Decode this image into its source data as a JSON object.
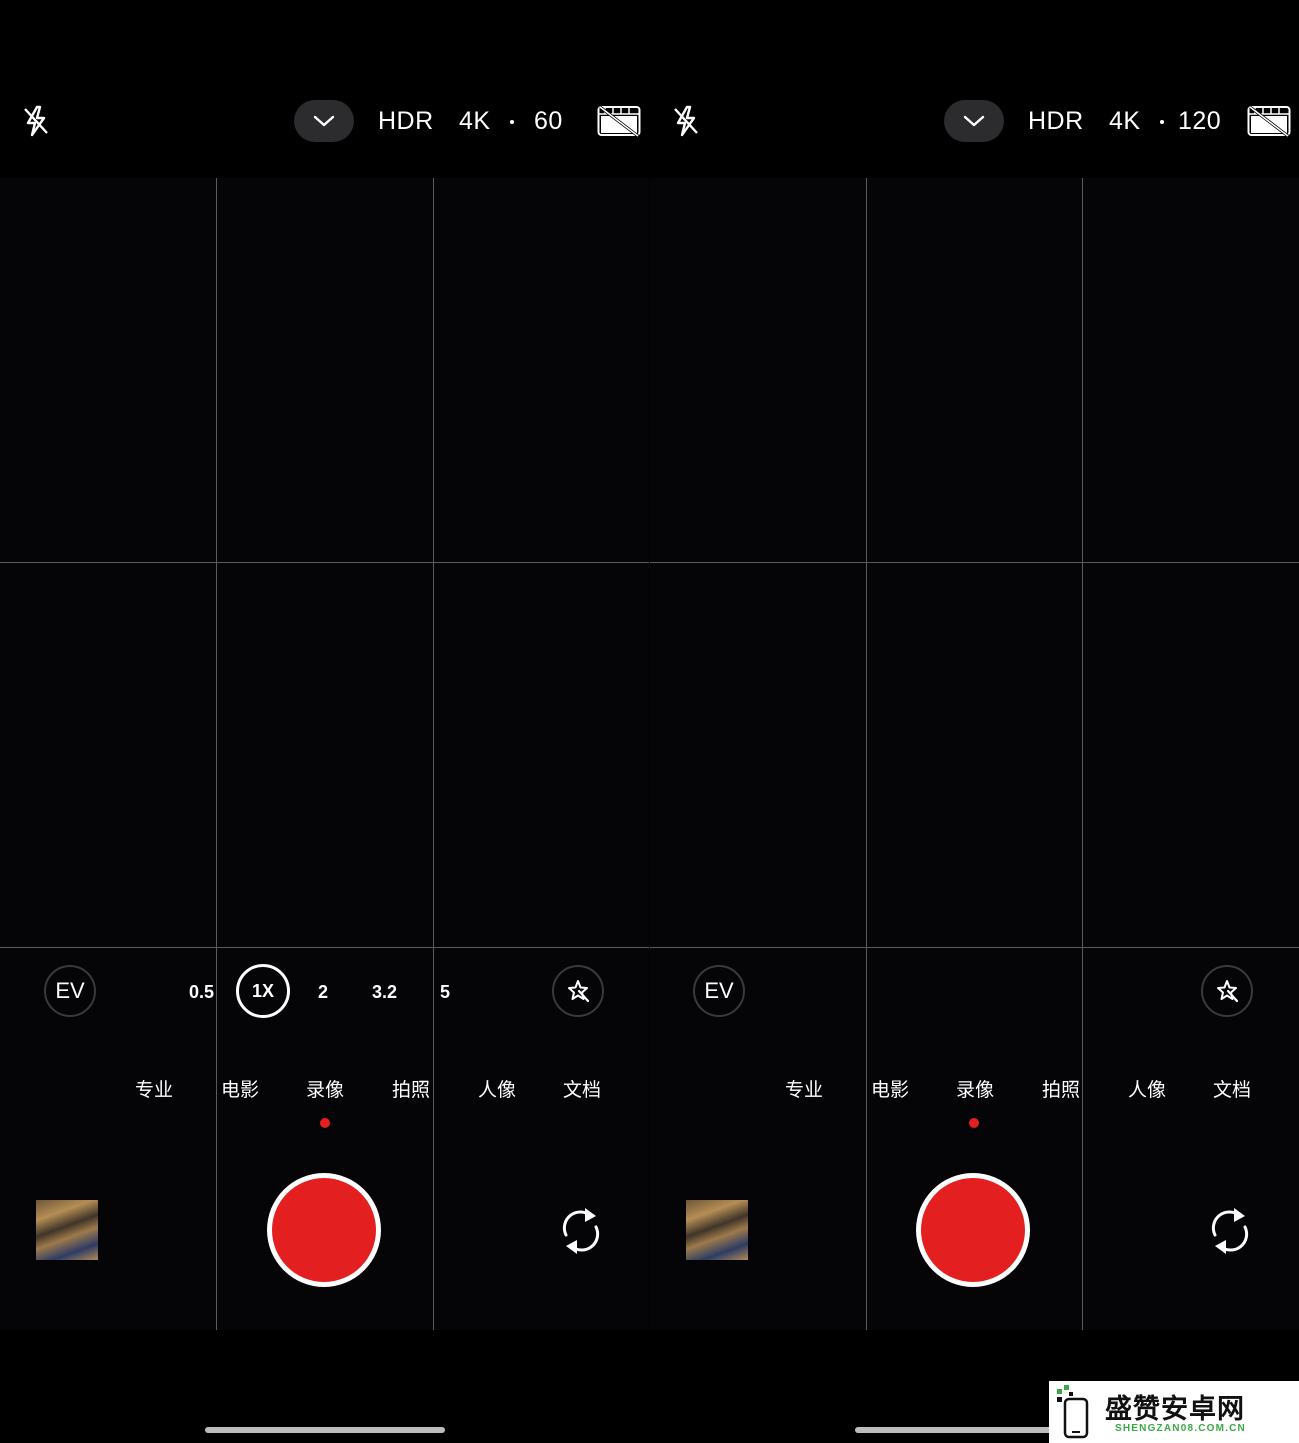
{
  "status": {
    "camera_indicator": "camera-icon"
  },
  "panels": [
    {
      "topbar": {
        "hdr": "HDR",
        "resolution": "4K",
        "separator": "·",
        "fps": "60",
        "master_cinema_logo": "MASTER CINEMA"
      },
      "ev_label": "EV",
      "zoom_levels": [
        "0.5",
        "1X",
        "2",
        "3.2",
        "5"
      ],
      "active_zoom": "1X",
      "modes": [
        "专业",
        "电影",
        "录像",
        "拍照",
        "人像",
        "文档"
      ],
      "active_mode": "录像"
    },
    {
      "topbar": {
        "hdr": "HDR",
        "resolution": "4K",
        "separator": "·",
        "fps": "120",
        "master_cinema_logo": "MASTER CINEMA"
      },
      "ev_label": "EV",
      "modes": [
        "专业",
        "电影",
        "录像",
        "拍照",
        "人像",
        "文档"
      ],
      "active_mode": "录像"
    }
  ],
  "watermark": {
    "title": "盛赞安卓网",
    "subtitle": "SHENGZAN08.COM.CN"
  },
  "colors": {
    "record_red": "#e31f1f",
    "indicator_green": "#3fcf6a"
  }
}
